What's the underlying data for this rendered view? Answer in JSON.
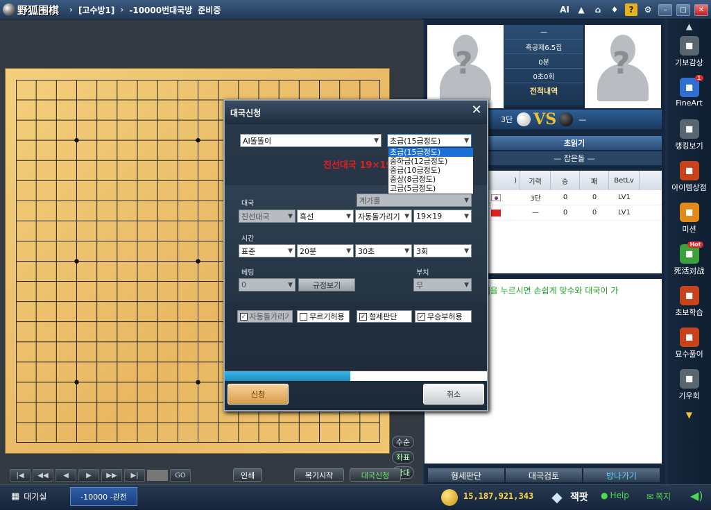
{
  "window": {
    "logo_text": "野狐围棋",
    "crumbs": [
      "[고수방1]",
      "-10000번대국방",
      "준비중"
    ],
    "top_ai": "AI",
    "top_help": "?"
  },
  "board": {
    "size": 19,
    "side_buttons": [
      "수순",
      "좌표",
      "확대"
    ],
    "controls": [
      "|◀",
      "◀◀",
      "◀",
      "▶",
      "▶▶",
      "▶|"
    ],
    "go_label": "GO",
    "print_label": "인쇄",
    "review_label": "복기시작",
    "match_label": "대국신청"
  },
  "players": {
    "rule": "흑공제6.5집",
    "time_main": "0분",
    "time_byo": "0초0회",
    "record_label": "전적내역",
    "dash_top": "—",
    "left_rank": "3단",
    "vs": "VS",
    "right_rank": "—",
    "read_label": "초읽기",
    "stone_label": "— 잡은돌 —"
  },
  "player_list": {
    "headers": [
      ")",
      "기력",
      "승",
      "패",
      "BetLv"
    ],
    "rows": [
      {
        "flag": "KR",
        "rank": "3단",
        "win": "0",
        "lose": "0",
        "lv": "LV1"
      },
      {
        "flag": "CN",
        "rank": "—",
        "win": "0",
        "lose": "0",
        "lv": "LV1"
      }
    ]
  },
  "chat": {
    "text": "]을 누르시면 손쉽게 맞수와 대국이 가"
  },
  "right_buttons": [
    "형세판단",
    "대국검토",
    "방나가기"
  ],
  "menu": [
    {
      "label": "기보감상",
      "icon": "record-icon",
      "color": "#5a6572"
    },
    {
      "label": "FineArt",
      "icon": "fineart-icon",
      "color": "#2f6fcf",
      "badge": "1"
    },
    {
      "label": "랭킹보기",
      "icon": "ranking-icon",
      "color": "#5a6572"
    },
    {
      "label": "아이템상점",
      "icon": "shop-icon",
      "color": "#c8431b"
    },
    {
      "label": "미션",
      "icon": "mission-icon",
      "color": "#e08a1a"
    },
    {
      "label": "死活对战",
      "icon": "battle-icon",
      "color": "#3ca13c",
      "badge": "Hot"
    },
    {
      "label": "초보학습",
      "icon": "learn-icon",
      "color": "#c8431b"
    },
    {
      "label": "묘수풀이",
      "icon": "puzzle-icon",
      "color": "#c8431b"
    },
    {
      "label": "기우회",
      "icon": "club-icon",
      "color": "#5a6572"
    }
  ],
  "status": {
    "lobby": "대기실",
    "tab": "-10000 -관전",
    "coins": "15,187,921,343",
    "brand": "잭팟",
    "help": "Help",
    "mail": "쪽지"
  },
  "dialog": {
    "title": "대국신청",
    "opponent": "AI똘똘이",
    "level": "초급(15급정도)",
    "level_options": [
      "초급(15급정도)",
      "중하급(12급정도)",
      "중급(10급정도)",
      "중상(8급정도)",
      "고급(5급정도)"
    ],
    "summary": "친선대국 19×19 3회",
    "label_match": "대국",
    "label_count": "계가룰",
    "match_type": "친선대국",
    "color": "흑선",
    "counting": "자동돌가리기",
    "boardsize": "19×19",
    "label_time": "시간",
    "time_type": "표준",
    "time_main": "20분",
    "time_byo": "30초",
    "time_count": "3회",
    "label_bet": "베팅",
    "label_handicap": "부치",
    "bet_value": "0",
    "rules_btn": "규정보기",
    "handicap": "무",
    "checks": [
      {
        "label": "자동돌가리기",
        "checked": true,
        "disabled": true
      },
      {
        "label": "무르기허용",
        "checked": false,
        "disabled": false
      },
      {
        "label": "형세판단",
        "checked": true,
        "disabled": false
      },
      {
        "label": "무승부허용",
        "checked": true,
        "disabled": false
      }
    ],
    "progress": 0.48,
    "apply": "신청",
    "cancel": "취소"
  },
  "colors": {
    "accent": "#1a6fd8",
    "board": "#eec06a",
    "chat_text": "#1aa62a"
  }
}
